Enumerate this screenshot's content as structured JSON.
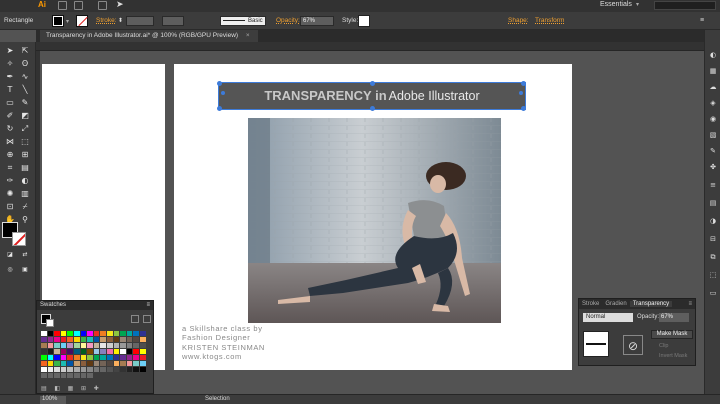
{
  "appbar": {
    "logo": "Ai",
    "workspace": "Essentials"
  },
  "control_bar": {
    "selection_type": "Rectangle",
    "stroke_label": "Stroke:",
    "brush_label": "Basic",
    "opacity_label": "Opacity:",
    "opacity_value": "67%",
    "style_label": "Style:",
    "shape_label": "Shape:",
    "transform_label": "Transform"
  },
  "document": {
    "tab_title": "Transparency in Adobe Illustrator.ai* @ 100% (RGB/GPU Preview)"
  },
  "artboard": {
    "title_bold": "TRANSPARENCY in",
    "title_light": "Adobe Illustrator",
    "credits": [
      "a Skillshare class by",
      "Fashion Designer",
      "KRISTEN STEINMAN",
      "www.ktogs.com"
    ]
  },
  "panels": {
    "swatches": {
      "title": "Swatches"
    },
    "transparency": {
      "tab_stroke": "Stroke",
      "tab_gradient": "Gradien",
      "tab_transparency": "Transparency",
      "blend_mode": "Normal",
      "opacity_label": "Opacity:",
      "opacity_value": "67%",
      "make_mask": "Make Mask",
      "clip": "Clip",
      "invert_mask": "Invert Mask"
    }
  },
  "status": {
    "zoom": "100%",
    "tool": "Selection"
  },
  "colors": {
    "accent": "#f0a030",
    "selection": "#3d7bd9",
    "ui_dark": "#3c3c3c",
    "canvas": "#535353"
  },
  "icons": [
    "illustrator-logo-icon",
    "selection-tool-icon",
    "direct-selection-icon",
    "pen-tool-icon",
    "type-tool-icon",
    "line-tool-icon",
    "rectangle-tool-icon",
    "paintbrush-icon",
    "pencil-icon",
    "eraser-icon",
    "rotate-icon",
    "scale-icon",
    "width-icon",
    "free-transform-icon",
    "shape-builder-icon",
    "perspective-icon",
    "mesh-icon",
    "gradient-icon",
    "eyedropper-icon",
    "blend-icon",
    "symbol-sprayer-icon",
    "graph-icon",
    "artboard-icon",
    "slice-icon",
    "hand-icon",
    "zoom-icon",
    "no-mask-icon"
  ]
}
